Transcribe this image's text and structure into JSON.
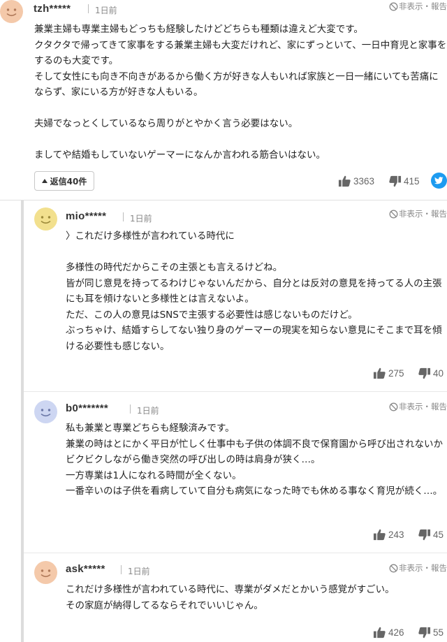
{
  "comments": [
    {
      "user": "tzh*****",
      "date": "1日前",
      "hide_label": "非表示",
      "report_label": "報告",
      "lines": [
        "兼業主婦も専業主婦もどっちも経験したけどどちらも種類は違えど大変です。",
        "クタクタで帰ってきて家事をする兼業主婦も大変だけれど、家にずっといて、一日中育児と家事をするのも大変です。",
        "そして女性にも向き不向きがあるから働く方が好きな人もいれば家族と一日一緒にいても苦痛にならず、家にいる方が好きな人もいる。",
        "",
        "夫婦でなっとくしているなら周りがとやかく言う必要はない。",
        "",
        "ましてや結婚もしていないゲーマーになんか言われる筋合いはない。"
      ],
      "reply_label": "返信40件",
      "likes": "3363",
      "dislikes": "415",
      "avatar_color": "#f4c9aa"
    },
    {
      "user": "mio*****",
      "date": "1日前",
      "hide_label": "非表示",
      "report_label": "報告",
      "lines": [
        "〉これだけ多様性が言われている時代に",
        "",
        "多様性の時代だからこその主張とも言えるけどね。",
        "皆が同じ意見を持ってるわけじゃないんだから、自分とは反対の意見を持ってる人の主張にも耳を傾けないと多様性とは言えないよ。",
        "ただ、この人の意見はSNSで主張する必要性は感じないものだけど。",
        "ぶっちゃけ、結婚すらしてない独り身のゲーマーの現実を知らない意見にそこまで耳を傾ける必要性も感じない。"
      ],
      "likes": "275",
      "dislikes": "40",
      "avatar_color": "#f2e08e"
    },
    {
      "user": "b0*******",
      "date": "1日前",
      "hide_label": "非表示",
      "report_label": "報告",
      "lines": [
        "私も兼業と専業どちらも経験済みです。",
        "兼業の時はとにかく平日が忙しく仕事中も子供の体調不良で保育園から呼び出されないかビクビクしながら働き突然の呼び出しの時は肩身が狭く…。",
        "一方専業は1人になれる時間が全くない。",
        "一番辛いのは子供を看病していて自分も病気になった時でも休める事なく育児が続く…。"
      ],
      "likes": "243",
      "dislikes": "45",
      "avatar_color": "#cdd6f2"
    },
    {
      "user": "ask*****",
      "date": "1日前",
      "hide_label": "非表示",
      "report_label": "報告",
      "lines": [
        "これだけ多様性が言われている時代に、専業がダメだとかいう感覚がすごい。",
        "その家庭が納得してるならそれでいいじゃん。"
      ],
      "likes": "426",
      "dislikes": "55",
      "avatar_color": "#f4c9aa"
    }
  ]
}
